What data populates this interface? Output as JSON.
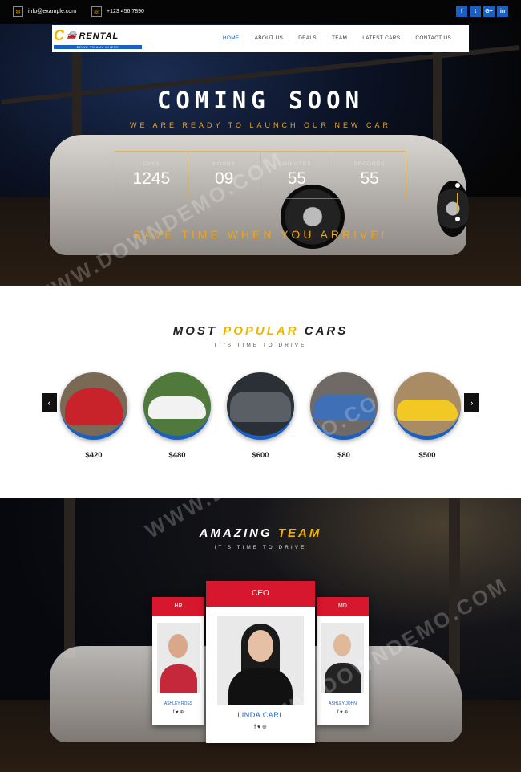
{
  "topbar": {
    "email": "info@example.com",
    "phone": "+123 456 7890",
    "social": [
      "f",
      "t",
      "G+",
      "in"
    ]
  },
  "nav": {
    "logo_text": "RENTAL",
    "logo_letter": "C",
    "logo_tagline": "DRIVE TO ANY WHERE",
    "items": [
      "HOME",
      "ABOUT US",
      "DEALS",
      "TEAM",
      "LATEST CARS",
      "CONTACT US"
    ],
    "active": "HOME"
  },
  "hero": {
    "title": "COMING SOON",
    "subtitle": "WE ARE READY TO LAUNCH OUR NEW CAR",
    "countdown": [
      {
        "label": "DAYS",
        "value": "1245"
      },
      {
        "label": "HOURS",
        "value": "09"
      },
      {
        "label": "MINUTES",
        "value": "55"
      },
      {
        "label": "SECONDS",
        "value": "55"
      }
    ],
    "tagline": "SAVE TIME WHEN YOU ARRIVE!"
  },
  "popular": {
    "title_a": "MOST",
    "title_b": "POPULAR",
    "title_c": "CARS",
    "subtitle": "IT'S TIME TO DRIVE",
    "prev": "‹",
    "next": "›",
    "cars": [
      {
        "price": "$420",
        "color": "#c8222b",
        "bg": "#7a6a55"
      },
      {
        "price": "$480",
        "color": "#f2f2f2",
        "bg": "#4f7a3c"
      },
      {
        "price": "$600",
        "color": "#5a5f66",
        "bg": "#2b2f36"
      },
      {
        "price": "$80",
        "color": "#3f6fb5",
        "bg": "#6f6a66"
      },
      {
        "price": "$500",
        "color": "#f2c824",
        "bg": "#a98c64"
      }
    ]
  },
  "team": {
    "title_a": "AMAZING",
    "title_b": "TEAM",
    "subtitle": "IT'S TIME TO DRIVE",
    "members": [
      {
        "role": "HR",
        "name": "ASHLEY ROSS",
        "social": "f ♥ ⊕"
      },
      {
        "role": "CEO",
        "name": "LINDA CARL",
        "social": "f ♥ ⊕"
      },
      {
        "role": "MD",
        "name": "ASHLEY JOHN",
        "social": "f ♥ ⊕"
      }
    ]
  },
  "watermark": "WWW.DOWNDEMO.COM"
}
